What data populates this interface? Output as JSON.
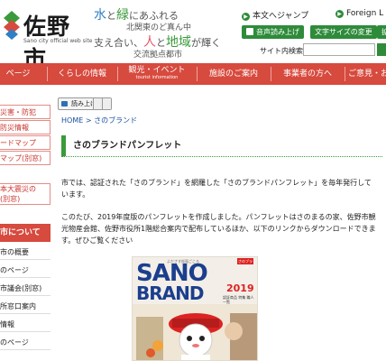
{
  "header": {
    "logo_name": "佐野市",
    "logo_sub": "Sano city official web site",
    "slogan": {
      "l1_a": "水",
      "l1_b": "と",
      "l1_c": "緑",
      "l1_d": "にあふれる",
      "l2": "北関東のど真ん中",
      "l3_a": "支え合い、",
      "l3_b": "人",
      "l3_c": "と",
      "l3_d": "地域",
      "l3_e": "が輝く",
      "l4": "交流拠点都市"
    },
    "skip_link": "本文へジャンプ",
    "foreign_link": "Foreign L",
    "voice_button": "音声読み上げ",
    "font_size_button": "文字サイズの変更",
    "extra_button": "拡",
    "search_label": "サイト内検索",
    "search_value": "",
    "colors": {
      "green": "#2e8b3a",
      "nav_red": "#d74a3e",
      "link_blue": "#1a4fa0"
    }
  },
  "nav": {
    "items": [
      {
        "label": "ページ"
      },
      {
        "label": "くらしの情報"
      },
      {
        "label": "観光・イベント",
        "sub": "tourist information"
      },
      {
        "label": "施設のご案内"
      },
      {
        "label": "事業者の方へ"
      },
      {
        "label": "ご意見・お"
      }
    ]
  },
  "sidebar": {
    "red_items": [
      "災害・防犯",
      "防災情報",
      "ードマップ",
      "マップ(別窓)"
    ],
    "red_item_extra": "本大震災の\n(別窓)",
    "heading": "市について",
    "plain_items": [
      "市の概要",
      "のページ",
      "市議会(別窓)",
      "所窓口案内",
      "情報",
      "のページ"
    ]
  },
  "main": {
    "read_button": "読み上げる",
    "breadcrumb": {
      "home": "HOME",
      "sep": ">",
      "current": "さのブランド"
    },
    "title": "さのブランドパンフレット",
    "para1": "市では、認証された「さのブランド」を網羅した「さのブランドパンフレット」を毎年発行しています。",
    "para2": "このたび、2019年度版のパンフレットを作成しました。パンフレットはさのまるの家、佐野市観光物産会館、佐野市役所1階総合案内で配布しているほか、以下のリンクからダウンロードできます。ぜひご覧ください",
    "cover": {
      "tag": "よださす仮面ごころ",
      "badge": "さのブランド",
      "title_1": "SANO",
      "title_2": "BRAND",
      "year": "2019",
      "meta": "認証商品 特集 職人 一覧"
    }
  }
}
